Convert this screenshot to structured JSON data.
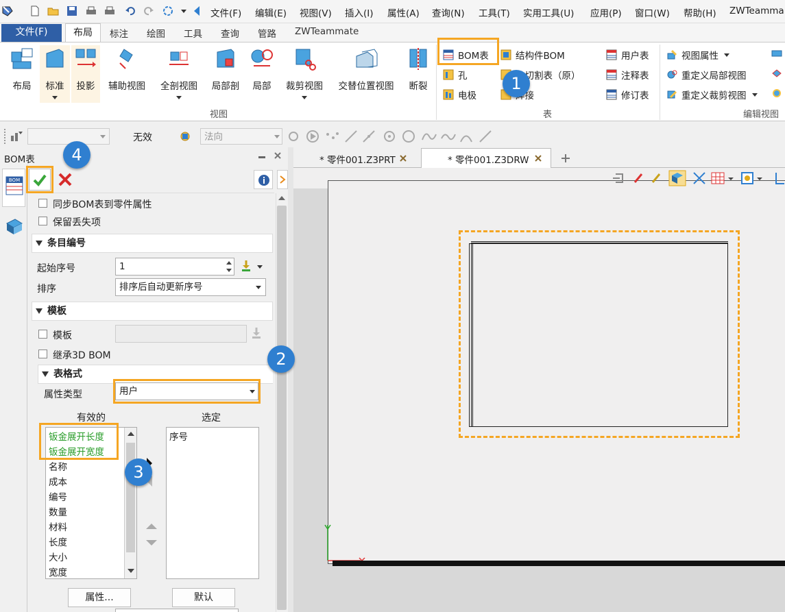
{
  "menubar": {
    "items": [
      "文件(F)",
      "编辑(E)",
      "视图(V)",
      "插入(I)",
      "属性(A)",
      "查询(N)",
      "工具(T)",
      "实用工具(U)",
      "应用(P)",
      "窗口(W)",
      "帮助(H)",
      "ZWTeamma"
    ]
  },
  "ribbon_tabs": {
    "file": "文件(F)",
    "items": [
      "布局",
      "标注",
      "绘图",
      "工具",
      "查询",
      "管路",
      "ZWTeammate"
    ],
    "active": "布局"
  },
  "ribbon": {
    "view_buttons": [
      "布局",
      "标准",
      "投影",
      "辅助视图",
      "全剖视图",
      "局部剖",
      "局部",
      "裁剪视图",
      "交替位置视图",
      "断裂"
    ],
    "view_group_label": "视图",
    "table_group": {
      "col1": [
        "BOM表",
        "孔",
        "电极"
      ],
      "col2": [
        "结构件BOM",
        "件切割表（原）",
        "焊接"
      ],
      "col3": [
        "用户表",
        "注释表",
        "修订表"
      ],
      "label": "表"
    },
    "edit_group": {
      "items": [
        "视图属性",
        "重定义局部视图",
        "重定义裁剪视图"
      ],
      "label": "编辑视图"
    }
  },
  "toolbar2": {
    "invalid_label": "无效",
    "normal_placeholder": "法向"
  },
  "bom_panel": {
    "title": "BOM表",
    "sync_label": "同步BOM表到零件属性",
    "keep_missing_label": "保留丢失项",
    "section_numbering": "条目编号",
    "start_no_label": "起始序号",
    "start_no_value": "1",
    "sort_label": "排序",
    "sort_value": "排序后自动更新序号",
    "section_template": "模板",
    "template_label": "模板",
    "inherit_label": "继承3D BOM",
    "section_format": "表格式",
    "attr_type_label": "属性类型",
    "attr_type_value": "用户",
    "available_header": "有效的",
    "selected_header": "选定",
    "available_items": [
      "钣金展开长度",
      "钣金展开宽度",
      "名称",
      "成本",
      "编号",
      "数量",
      "材料",
      "长度",
      "大小",
      "宽度"
    ],
    "selected_items": [
      "序号"
    ],
    "attr_button": "属性...",
    "default_button": "默认"
  },
  "doc_tabs": {
    "tab1": "* 零件001.Z3PRT",
    "tab2": "* 零件001.Z3DRW"
  },
  "badges": [
    "1",
    "2",
    "3",
    "4"
  ],
  "colors": {
    "accent": "#f5a623",
    "badge": "#2f7fd0",
    "file_tab": "#2f5fa6",
    "highlight_text": "#2a9d2a"
  }
}
